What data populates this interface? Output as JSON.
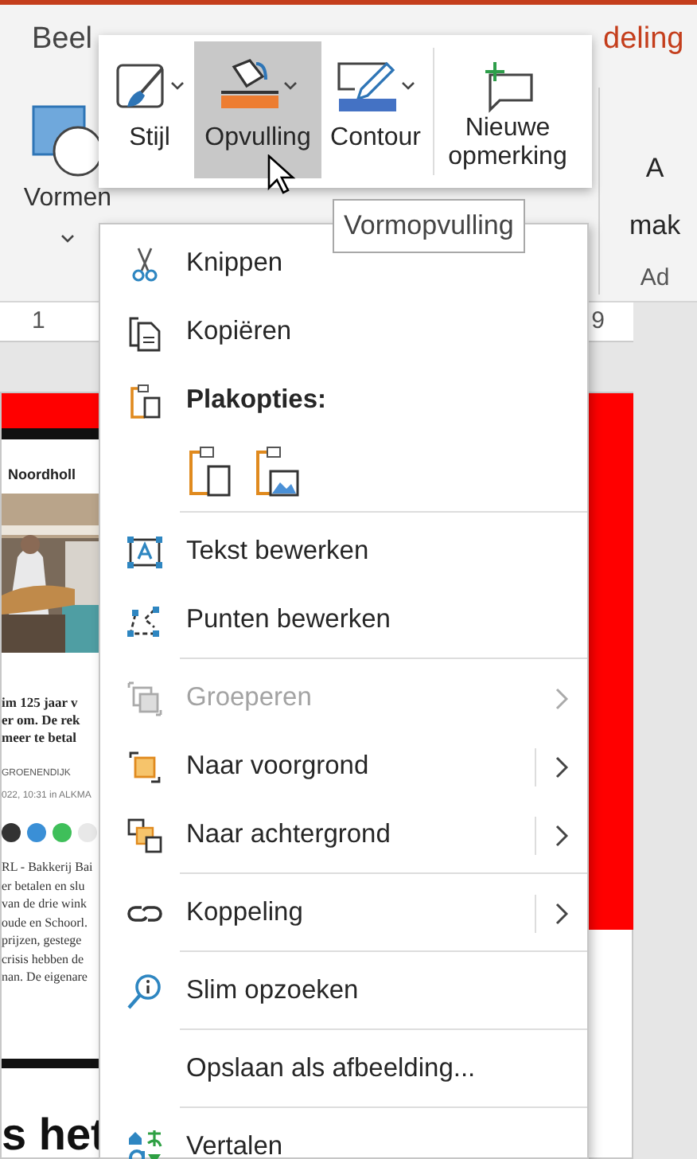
{
  "ribbon": {
    "tabs": [
      {
        "label": "Beel",
        "selected": false
      },
      {
        "label": "deling",
        "selected": true
      }
    ],
    "groups": [
      {
        "label": "Vormen"
      }
    ],
    "cut_group": {
      "lines": [
        "A",
        "mak"
      ],
      "group_label": "Ad"
    }
  },
  "ruler": {
    "marks": [
      "1",
      "9"
    ]
  },
  "slide": {
    "article": {
      "brand": "Noordholl",
      "headline": [
        "im 125 jaar v",
        "er om. De rek",
        "meer te betal"
      ],
      "byline": "GROENENDIJK",
      "dateline": "022, 10:31 in ALKMA",
      "body": [
        "RL - Bakkerij Bai",
        "er betalen en slu",
        "van de drie wink",
        "oude en Schoorl.",
        "prijzen, gestege",
        "crisis hebben de",
        "nan. De eigenare"
      ]
    },
    "big_text": "s het"
  },
  "mini_toolbar": {
    "buttons": [
      {
        "label": "Stijl",
        "dropdown": true,
        "selected": false
      },
      {
        "label": "Opvulling",
        "dropdown": true,
        "selected": true,
        "color": "#ed7d31"
      },
      {
        "label": "Contour",
        "dropdown": true,
        "selected": false,
        "color": "#4472c4"
      },
      {
        "label": "Nieuwe opmerking",
        "dropdown": false,
        "selected": false
      }
    ]
  },
  "tooltip": "Vormopvulling",
  "context_menu": {
    "sections": [
      [
        {
          "kind": "command",
          "label": "Knippen",
          "disabled": false,
          "submenu": false
        },
        {
          "kind": "command",
          "label": "Kopiëren",
          "disabled": false,
          "submenu": false
        },
        {
          "kind": "header",
          "label": "Plakopties:"
        },
        {
          "kind": "paste_options"
        }
      ],
      [
        {
          "kind": "command",
          "label": "Tekst bewerken",
          "disabled": false,
          "submenu": false
        },
        {
          "kind": "command",
          "label": "Punten bewerken",
          "disabled": false,
          "submenu": false
        }
      ],
      [
        {
          "kind": "command",
          "label": "Groeperen",
          "disabled": true,
          "submenu": true
        },
        {
          "kind": "command",
          "label": "Naar voorgrond",
          "disabled": false,
          "submenu": true
        },
        {
          "kind": "command",
          "label": "Naar achtergrond",
          "disabled": false,
          "submenu": true
        }
      ],
      [
        {
          "kind": "command",
          "label": "Koppeling",
          "disabled": false,
          "submenu": true
        }
      ],
      [
        {
          "kind": "command",
          "label": "Slim opzoeken",
          "disabled": false,
          "submenu": false
        }
      ],
      [
        {
          "kind": "command",
          "label": "Opslaan als afbeelding...",
          "disabled": false,
          "submenu": false
        }
      ],
      [
        {
          "kind": "command",
          "label": "Vertalen",
          "disabled": false,
          "submenu": false
        }
      ]
    ]
  }
}
